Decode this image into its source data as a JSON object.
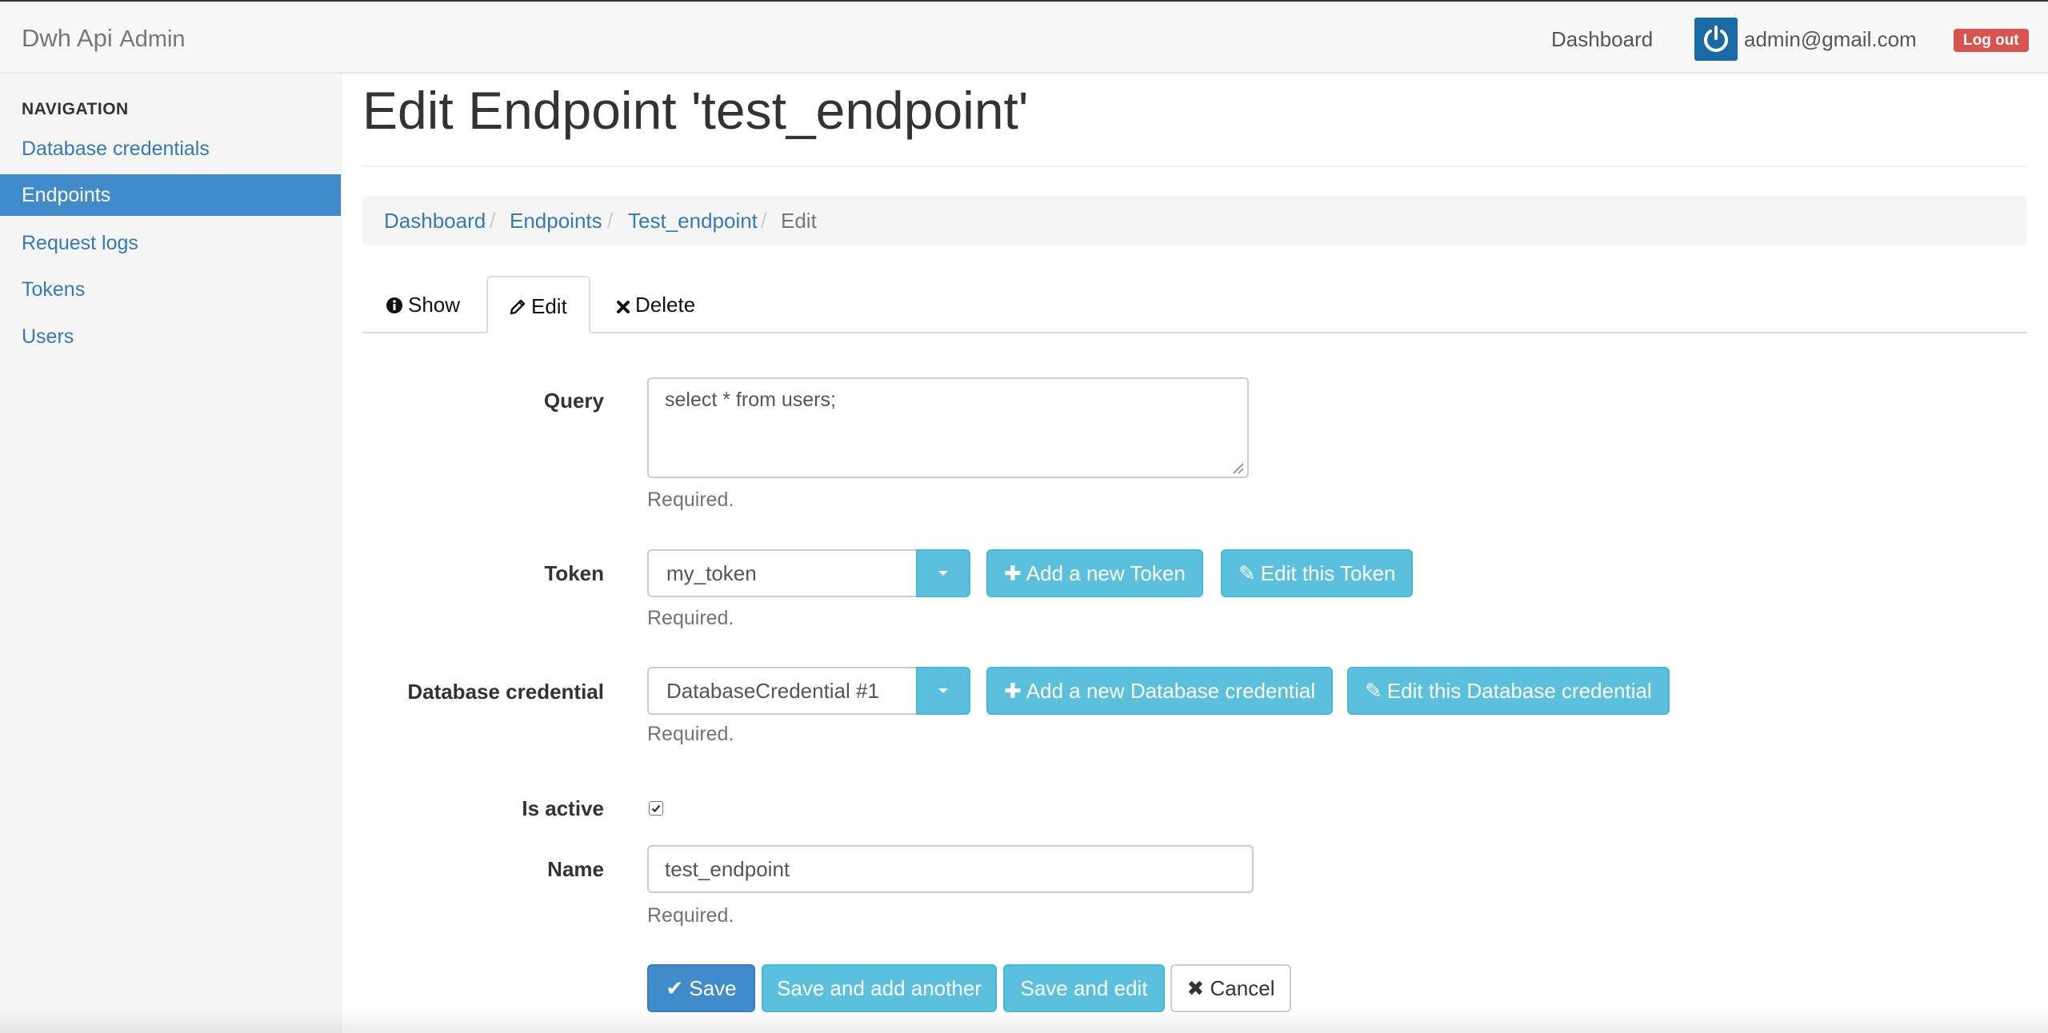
{
  "navbar": {
    "brand": "Dwh Api",
    "brand_sub": "Admin",
    "dashboard_link": "Dashboard",
    "user_email": "admin@gmail.com",
    "logout_label": "Log out"
  },
  "sidebar": {
    "header": "NAVIGATION",
    "items": [
      {
        "label": "Database credentials"
      },
      {
        "label": "Endpoints"
      },
      {
        "label": "Request logs"
      },
      {
        "label": "Tokens"
      },
      {
        "label": "Users"
      }
    ],
    "active_item": "Endpoints"
  },
  "page": {
    "title": "Edit Endpoint 'test_endpoint'"
  },
  "breadcrumb": {
    "items": [
      "Dashboard",
      "Endpoints",
      "Test_endpoint",
      "Edit"
    ],
    "separator": "/"
  },
  "tabs": [
    {
      "label": "Show",
      "icon": "info-icon"
    },
    {
      "label": "Edit",
      "icon": "pencil-icon"
    },
    {
      "label": "Delete",
      "icon": "times-icon"
    }
  ],
  "form": {
    "query": {
      "label": "Query",
      "value": "select * from users;",
      "help": "Required."
    },
    "token": {
      "label": "Token",
      "value": "my_token",
      "help": "Required.",
      "add_label": "Add a new Token",
      "edit_label": "Edit this Token"
    },
    "database_credential": {
      "label": "Database credential",
      "value": "DatabaseCredential #1",
      "help": "Required.",
      "add_label": "Add a new Database credential",
      "edit_label": "Edit this Database credential"
    },
    "is_active": {
      "label": "Is active",
      "checked": true
    },
    "name": {
      "label": "Name",
      "value": "test_endpoint",
      "help": "Required."
    }
  },
  "actions": {
    "save": "Save",
    "save_add": "Save and add another",
    "save_edit": "Save and edit",
    "cancel": "Cancel"
  },
  "colors": {
    "primary": "#428bca",
    "info": "#5bc0de",
    "danger": "#d9534f",
    "link": "#337ab7"
  }
}
